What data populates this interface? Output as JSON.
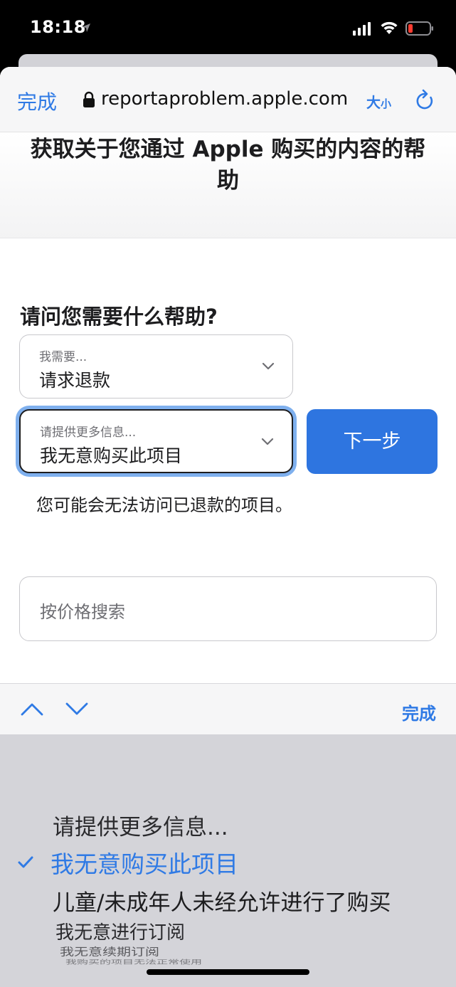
{
  "status_bar": {
    "time": "18:18"
  },
  "browser": {
    "done_label": "完成",
    "url": "reportaproblem.apple.com",
    "text_size_big": "大",
    "text_size_small": "小"
  },
  "page": {
    "title": "获取关于您通过 Apple 购买的内容的帮助",
    "question": "请问您需要什么帮助?",
    "select_1": {
      "label": "我需要...",
      "value": "请求退款"
    },
    "select_2": {
      "label": "请提供更多信息...",
      "value": "我无意购买此项目"
    },
    "next_button": "下一步",
    "notice": "您可能会无法访问已退款的项目。",
    "search_placeholder": "按价格搜索"
  },
  "accessory": {
    "done_label": "完成"
  },
  "picker": {
    "selected_index": 1,
    "options": [
      "请提供更多信息...",
      "我无意购买此项目",
      "儿童/未成年人未经允许进行了购买",
      "我无意进行订阅",
      "我无意续期订阅",
      "我购买的项目无法正常使用"
    ]
  },
  "colors": {
    "accent": "#2f7ae5",
    "next_button": "#2e75e0",
    "focus_ring": "#7fb0ee",
    "picker_bg": "#d4d4d9"
  }
}
